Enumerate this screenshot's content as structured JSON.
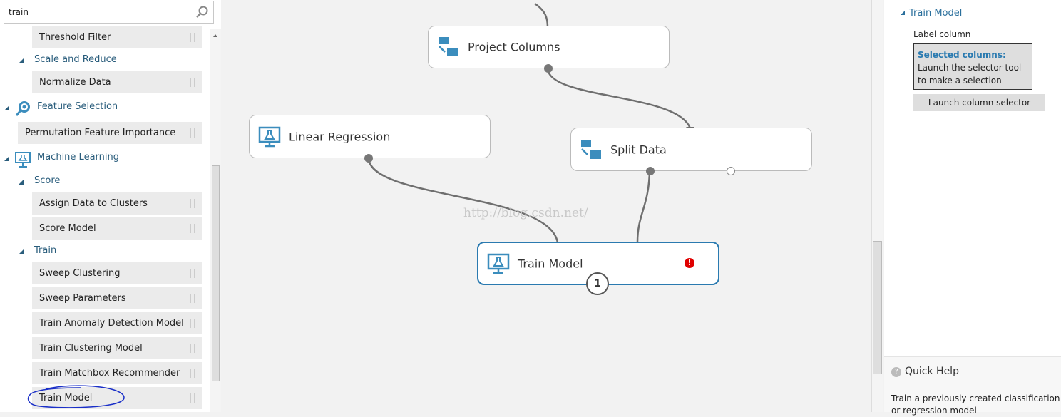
{
  "palette": {
    "search_value": "train",
    "items": [
      {
        "kind": "item",
        "label": "Threshold Filter"
      },
      {
        "kind": "subcat",
        "label": "Scale and Reduce"
      },
      {
        "kind": "item",
        "label": "Normalize Data"
      },
      {
        "kind": "cat",
        "label": "Feature Selection",
        "icon": "magnifier-icon"
      },
      {
        "kind": "item",
        "label": "Permutation Feature Importance"
      },
      {
        "kind": "cat",
        "label": "Machine Learning",
        "icon": "flask-monitor-icon"
      },
      {
        "kind": "subcat",
        "label": "Score"
      },
      {
        "kind": "item",
        "label": "Assign Data to Clusters"
      },
      {
        "kind": "item",
        "label": "Score Model"
      },
      {
        "kind": "subcat",
        "label": "Train"
      },
      {
        "kind": "item",
        "label": "Sweep Clustering"
      },
      {
        "kind": "item",
        "label": "Sweep Parameters"
      },
      {
        "kind": "item",
        "label": "Train Anomaly Detection Model"
      },
      {
        "kind": "item",
        "label": "Train Clustering Model"
      },
      {
        "kind": "item",
        "label": "Train Matchbox Recommender"
      },
      {
        "kind": "item",
        "label": "Train Model"
      }
    ]
  },
  "canvas": {
    "nodes": {
      "project_columns": "Project Columns",
      "linear_regression": "Linear Regression",
      "split_data": "Split Data",
      "train_model": "Train Model"
    },
    "train_model_badge": "1",
    "error_icon": "!",
    "watermark": "http://blog.csdn.net/",
    "selected_color": "#2a7ab0",
    "error_color": "#e00000"
  },
  "properties": {
    "title": "Train Model",
    "label_column": "Label column",
    "selected_columns_heading": "Selected columns:",
    "selected_columns_text": "Launch the selector tool to make a selection",
    "launch_button": "Launch column selector"
  },
  "quick_help": {
    "title": "Quick Help",
    "text": "Train a previously created classification or regression model"
  }
}
